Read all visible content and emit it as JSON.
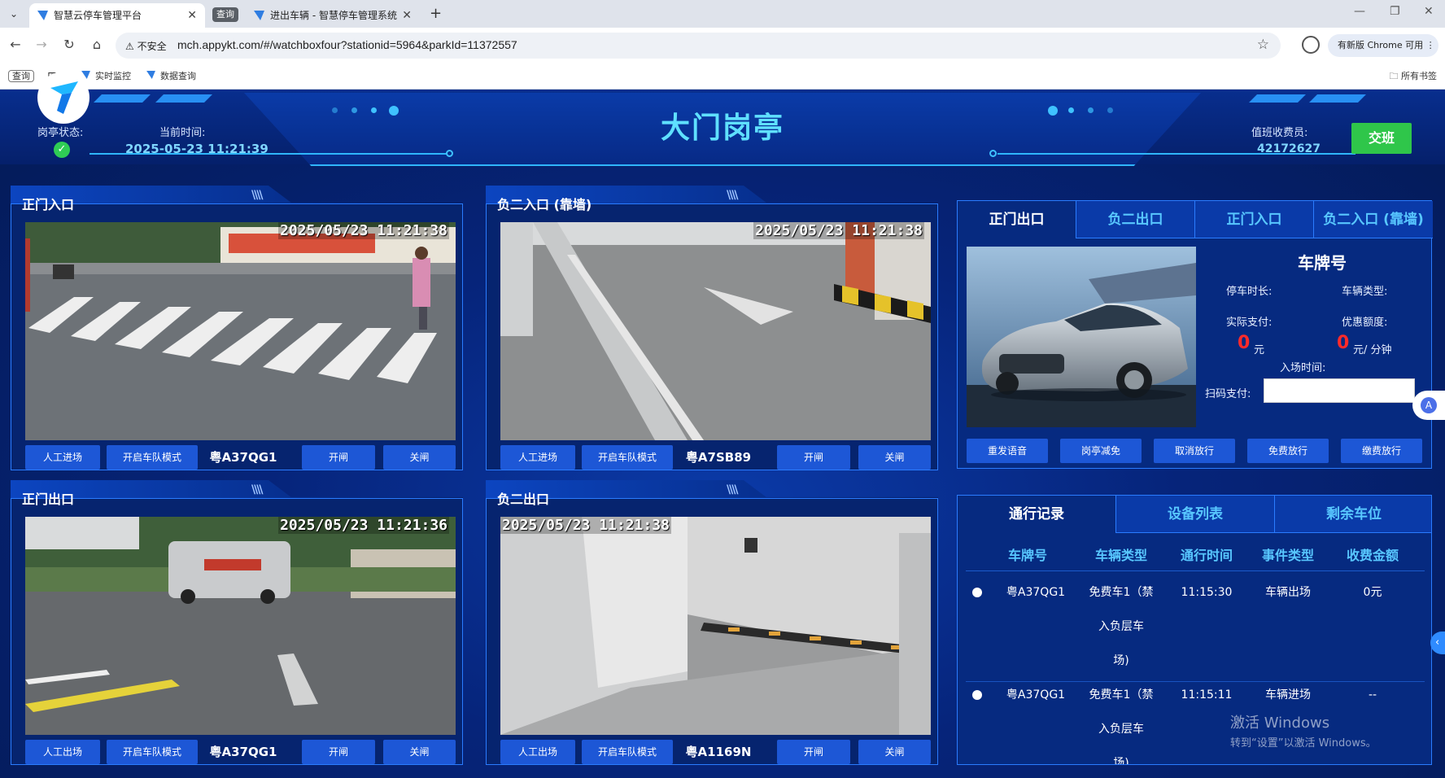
{
  "browser": {
    "tab_active_title": "智慧云停车管理平台",
    "tab_group_label": "查询",
    "tab_inactive_title": "进出车辆 - 智慧停车管理系统",
    "insecure_label": "不安全",
    "url": "mch.appykt.com/#/watchboxfour?stationid=5964&parkId=11372557",
    "update_label": "有新版 Chrome 可用",
    "bookmarks": [
      "查询",
      "实时监控",
      "数据查询"
    ],
    "all_bookmarks": "所有书签"
  },
  "header": {
    "title": "大门岗亭",
    "booth_status_label": "岗亭状态:",
    "current_time_label": "当前时间:",
    "current_time": "2025-05-23 11:21:39",
    "cashier_label": "值班收费员:",
    "cashier_id": "42172627",
    "handover_label": "交班"
  },
  "cameras": [
    {
      "title": "正门入口",
      "timestamp": "2025/05/23  11:21:38",
      "manual_label": "人工进场",
      "fleet_label": "开启车队模式",
      "plate": "粤A37QG1",
      "open_label": "开闸",
      "close_label": "关闸"
    },
    {
      "title": "负二入口 (靠墙)",
      "timestamp": "2025/05/23  11:21:38",
      "manual_label": "人工进场",
      "fleet_label": "开启车队模式",
      "plate": "粤A7SB89",
      "open_label": "开闸",
      "close_label": "关闸"
    },
    {
      "title": "正门出口",
      "timestamp": "2025/05/23  11:21:36",
      "manual_label": "人工出场",
      "fleet_label": "开启车队模式",
      "plate": "粤A37QG1",
      "open_label": "开闸",
      "close_label": "关闸"
    },
    {
      "title": "负二出口",
      "timestamp": "2025/05/23  11:21:38",
      "manual_label": "人工出场",
      "fleet_label": "开启车队模式",
      "plate": "粤A1169N",
      "open_label": "开闸",
      "close_label": "关闸"
    }
  ],
  "vehicle_panel": {
    "tabs": [
      "正门出口",
      "负二出口",
      "正门入口",
      "负二入口 (靠墙)"
    ],
    "plate_title": "车牌号",
    "parking_duration_label": "停车时长:",
    "vehicle_type_label": "车辆类型:",
    "actual_paid_label": "实际支付:",
    "discount_label": "优惠额度:",
    "actual_paid_value": "0",
    "actual_paid_unit": "元",
    "discount_value": "0",
    "discount_unit": "元/ 分钟",
    "entry_time_label": "入场时间:",
    "scan_pay_label": "扫码支付:",
    "buttons": [
      "重发语音",
      "岗亭减免",
      "取消放行",
      "免费放行",
      "缴费放行"
    ]
  },
  "records_panel": {
    "tabs": [
      "通行记录",
      "设备列表",
      "剩余车位"
    ],
    "columns": [
      "车牌号",
      "车辆类型",
      "通行时间",
      "事件类型",
      "收费金额"
    ],
    "rows": [
      {
        "plate": "粤A37QG1",
        "type_lines": [
          "免费车1（禁",
          "入负层车",
          "场)"
        ],
        "time": "11:15:30",
        "event": "车辆出场",
        "fee": "0元"
      },
      {
        "plate": "粤A37QG1",
        "type_lines": [
          "免费车1（禁",
          "入负层车",
          "场)"
        ],
        "time": "11:15:11",
        "event": "车辆进场",
        "fee": "--"
      }
    ]
  },
  "watermark": {
    "line1": "激活 Windows",
    "line2": "转到“设置”以激活 Windows。"
  }
}
